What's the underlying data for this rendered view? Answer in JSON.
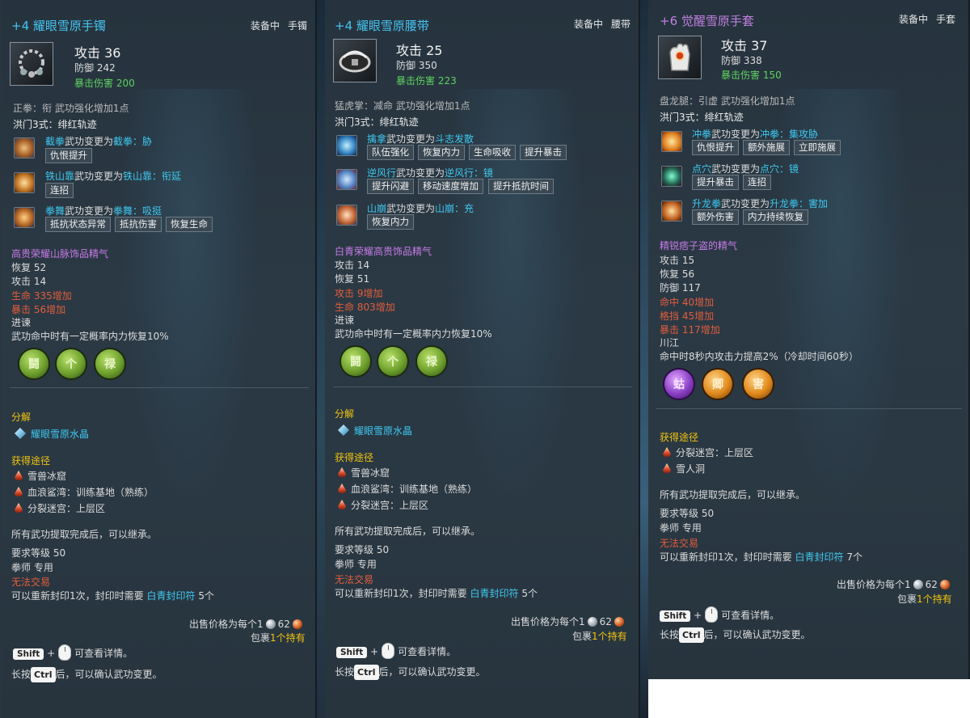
{
  "panels": [
    {
      "title": "+4 耀眼雪原手镯",
      "equip_status": "装备中",
      "slot": "手镯",
      "attack": "攻击 36",
      "defense": "防御 242",
      "crit_damage": "暴击伤害 200",
      "school_line": "正拳：衔 武功强化增加1点",
      "combo_title": "洪门3式：绯红轨迹",
      "skills": [
        {
          "icon": "punch-skill-icon",
          "name": "截拳",
          "mid": "武功变更为",
          "result": "截拳：胁",
          "chips": [
            "仇恨提升"
          ]
        },
        {
          "icon": "shoulder-skill-icon",
          "name": "铁山靠",
          "mid": "武功变更为",
          "result": "铁山靠：衔延",
          "chips": [
            "连招"
          ]
        },
        {
          "icon": "dance-skill-icon",
          "name": "拳舞",
          "mid": "武功变更为",
          "result": "拳舞：吸挺",
          "chips": [
            "抵抗状态异常",
            "抵抗伤害",
            "恢复生命"
          ]
        }
      ],
      "spirit_title": "高贵荣耀山脉饰品精气",
      "spirit_stats": [
        "恢复 52",
        "攻击 14"
      ],
      "spirit_bonus": [
        "生命 335增加",
        "暴击 56增加"
      ],
      "spirit_effect_title": "进谏",
      "spirit_effect_desc": "武功命中时有一定概率内力恢复10%",
      "gems": [
        "鬪",
        "个",
        "禄"
      ],
      "decompose_title": "分解",
      "decompose_item": "耀眼雪原水晶",
      "source_title": "获得途径",
      "sources": [
        "雪兽冰窟",
        "血浪鲨湾：训练基地（熟练）",
        "分裂迷宫：上层区"
      ],
      "inherit_note": "所有武功提取完成后，可以继承。",
      "req_level": "要求等级 50",
      "class_only": "拳师 专用",
      "no_trade": "无法交易",
      "reseal_prefix": "可以重新封印1次，封印时需要",
      "reseal_item": "白青封印符",
      "reseal_count": "5个",
      "sell_prefix": "出售价格为每个1",
      "sell_copper": "62",
      "bag_prefix": "包裹",
      "bag_count": "1个持有",
      "shift_key": "Shift",
      "plus": "+",
      "detail_hint": "可查看详情。",
      "ctrl_prefix": "长按",
      "ctrl_key": "Ctrl",
      "ctrl_hint": "后，可以确认武功变更。"
    },
    {
      "title": "+4 耀眼雪原腰带",
      "equip_status": "装备中",
      "slot": "腰带",
      "attack": "攻击 25",
      "defense": "防御 350",
      "crit_damage": "暴击伤害 223",
      "school_line": "猛虎掌：减命 武功强化增加1点",
      "combo_title": "洪门3式：绯红轨迹",
      "skills": [
        {
          "icon": "palm-skill-icon",
          "name": "擒拿",
          "mid": "武功变更为",
          "result": "斗志发散",
          "chips": [
            "队伍强化",
            "恢复内力",
            "生命吸收",
            "提升暴击"
          ]
        },
        {
          "icon": "wind-skill-icon",
          "name": "逆风行",
          "mid": "武功变更为",
          "result": "逆风行：镜",
          "chips": [
            "提升闪避",
            "移动速度增加",
            "提升抵抗时间"
          ]
        },
        {
          "icon": "mountain-skill-icon",
          "name": "山崩",
          "mid": "武功变更为",
          "result": "山崩：充",
          "chips": [
            "恢复内力"
          ]
        }
      ],
      "spirit_title": "白青荣耀高贵饰品精气",
      "spirit_stats": [
        "攻击 14",
        "恢复 51"
      ],
      "spirit_bonus": [
        "攻击 9增加",
        "生命 803增加"
      ],
      "spirit_effect_title": "进谏",
      "spirit_effect_desc": "武功命中时有一定概率内力恢复10%",
      "gems": [
        "鬪",
        "个",
        "禄"
      ],
      "decompose_title": "分解",
      "decompose_item": "耀眼雪原水晶",
      "source_title": "获得途径",
      "sources": [
        "雪兽冰窟",
        "血浪鲨湾：训练基地（熟练）",
        "分裂迷宫：上层区"
      ],
      "inherit_note": "所有武功提取完成后，可以继承。",
      "req_level": "要求等级 50",
      "class_only": "拳师 专用",
      "no_trade": "无法交易",
      "reseal_prefix": "可以重新封印1次，封印时需要",
      "reseal_item": "白青封印符",
      "reseal_count": "5个",
      "sell_prefix": "出售价格为每个1",
      "sell_copper": "62",
      "bag_prefix": "包裹",
      "bag_count": "1个持有",
      "shift_key": "Shift",
      "plus": "+",
      "detail_hint": "可查看详情。",
      "ctrl_prefix": "长按",
      "ctrl_key": "Ctrl",
      "ctrl_hint": "后，可以确认武功变更。"
    },
    {
      "title": "+6 觉醒雪原手套",
      "equip_status": "装备中",
      "slot": "手套",
      "attack": "攻击 37",
      "defense": "防御 338",
      "crit_damage": "暴击伤害 150",
      "school_line": "盘龙腿：引虚 武功强化增加1点",
      "combo_title": "洪门3式：绯红轨迹",
      "skills": [
        {
          "icon": "rush-fist-skill-icon",
          "name": "冲拳",
          "mid": "武功变更为",
          "result": "冲拳：集攻胁",
          "chips": [
            "仇恨提升",
            "额外施展",
            "立即施展"
          ]
        },
        {
          "icon": "acupoint-skill-icon",
          "name": "点穴",
          "mid": "武功变更为",
          "result": "点穴：镜",
          "chips": [
            "提升暴击",
            "连招"
          ]
        },
        {
          "icon": "rising-dragon-skill-icon",
          "name": "升龙拳",
          "mid": "武功变更为",
          "result": "升龙拳：害加",
          "chips": [
            "额外伤害",
            "内力持续恢复"
          ]
        }
      ],
      "spirit_title": "精锐痞子盗的精气",
      "spirit_stats": [
        "攻击 15",
        "恢复 56",
        "防御 117"
      ],
      "spirit_bonus": [
        "命中 40增加",
        "格挡 45增加",
        "暴击 117增加"
      ],
      "spirit_effect_title": "川江",
      "spirit_effect_desc": "命中时8秒内攻击力提高2%（冷却时间60秒）",
      "gems": [
        "蛄",
        "卿",
        "害"
      ],
      "source_title": "获得途径",
      "sources": [
        "分裂迷宫：上层区",
        "雪人洞"
      ],
      "inherit_note": "所有武功提取完成后，可以继承。",
      "req_level": "要求等级 50",
      "class_only": "拳师 专用",
      "no_trade": "无法交易",
      "reseal_prefix": "可以重新封印1次，封印时需要",
      "reseal_item": "白青封印符",
      "reseal_count": "7个",
      "sell_prefix": "出售价格为每个1",
      "sell_copper": "62",
      "bag_prefix": "包裹",
      "bag_count": "1个持有",
      "shift_key": "Shift",
      "plus": "+",
      "detail_hint": "可查看详情。",
      "ctrl_prefix": "长按",
      "ctrl_key": "Ctrl",
      "ctrl_hint": "后，可以确认武功变更。"
    }
  ],
  "colors": {
    "title_blue": "#46c3f0",
    "title_awakened": "#c07fe0",
    "crit_green": "#5ed25e",
    "spirit_purple": "#c77ae8",
    "bonus_red": "#e25d3c",
    "section_yellow": "#f1c40f",
    "panel_bg": "#2b3944"
  }
}
